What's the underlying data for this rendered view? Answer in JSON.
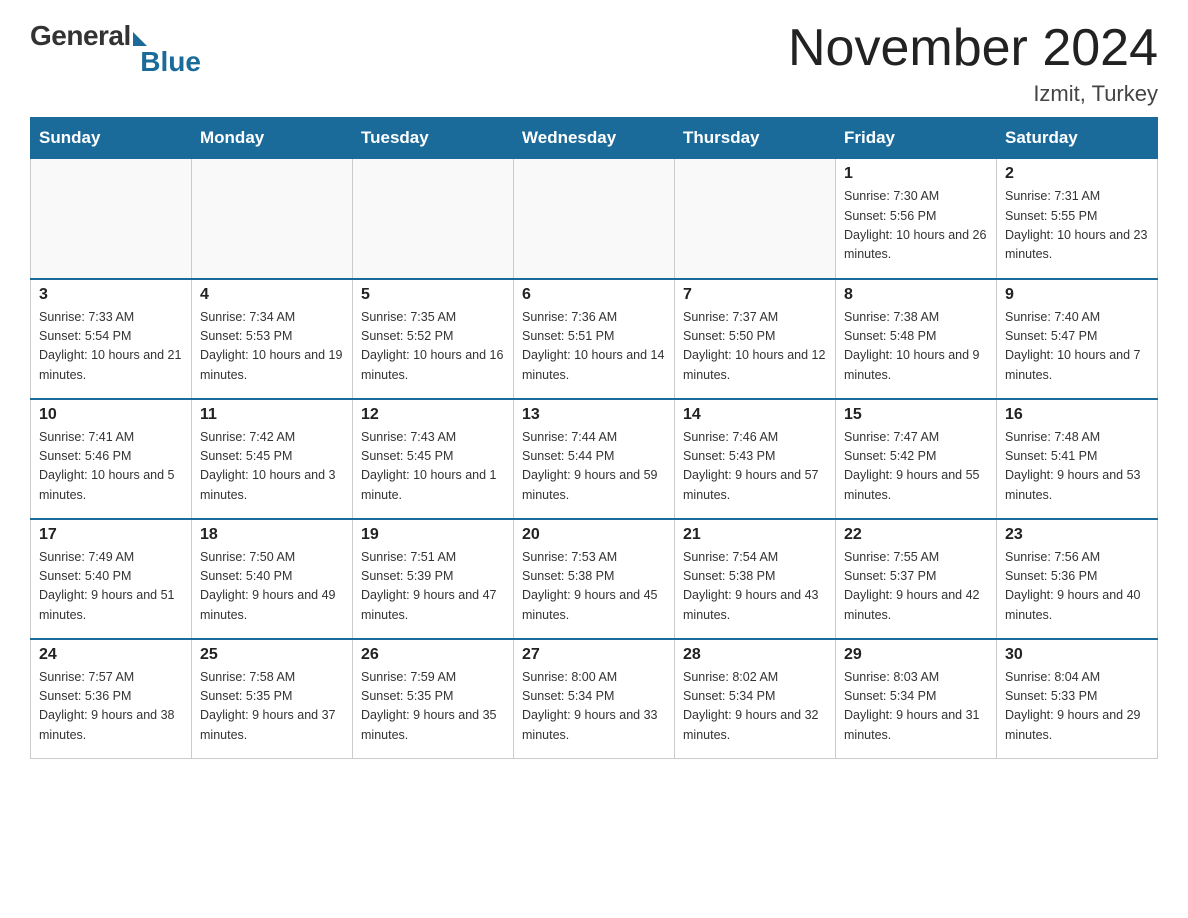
{
  "logo": {
    "general": "General",
    "blue": "Blue"
  },
  "title": "November 2024",
  "location": "Izmit, Turkey",
  "weekdays": [
    "Sunday",
    "Monday",
    "Tuesday",
    "Wednesday",
    "Thursday",
    "Friday",
    "Saturday"
  ],
  "weeks": [
    [
      {
        "day": "",
        "sunrise": "",
        "sunset": "",
        "daylight": ""
      },
      {
        "day": "",
        "sunrise": "",
        "sunset": "",
        "daylight": ""
      },
      {
        "day": "",
        "sunrise": "",
        "sunset": "",
        "daylight": ""
      },
      {
        "day": "",
        "sunrise": "",
        "sunset": "",
        "daylight": ""
      },
      {
        "day": "",
        "sunrise": "",
        "sunset": "",
        "daylight": ""
      },
      {
        "day": "1",
        "sunrise": "Sunrise: 7:30 AM",
        "sunset": "Sunset: 5:56 PM",
        "daylight": "Daylight: 10 hours and 26 minutes."
      },
      {
        "day": "2",
        "sunrise": "Sunrise: 7:31 AM",
        "sunset": "Sunset: 5:55 PM",
        "daylight": "Daylight: 10 hours and 23 minutes."
      }
    ],
    [
      {
        "day": "3",
        "sunrise": "Sunrise: 7:33 AM",
        "sunset": "Sunset: 5:54 PM",
        "daylight": "Daylight: 10 hours and 21 minutes."
      },
      {
        "day": "4",
        "sunrise": "Sunrise: 7:34 AM",
        "sunset": "Sunset: 5:53 PM",
        "daylight": "Daylight: 10 hours and 19 minutes."
      },
      {
        "day": "5",
        "sunrise": "Sunrise: 7:35 AM",
        "sunset": "Sunset: 5:52 PM",
        "daylight": "Daylight: 10 hours and 16 minutes."
      },
      {
        "day": "6",
        "sunrise": "Sunrise: 7:36 AM",
        "sunset": "Sunset: 5:51 PM",
        "daylight": "Daylight: 10 hours and 14 minutes."
      },
      {
        "day": "7",
        "sunrise": "Sunrise: 7:37 AM",
        "sunset": "Sunset: 5:50 PM",
        "daylight": "Daylight: 10 hours and 12 minutes."
      },
      {
        "day": "8",
        "sunrise": "Sunrise: 7:38 AM",
        "sunset": "Sunset: 5:48 PM",
        "daylight": "Daylight: 10 hours and 9 minutes."
      },
      {
        "day": "9",
        "sunrise": "Sunrise: 7:40 AM",
        "sunset": "Sunset: 5:47 PM",
        "daylight": "Daylight: 10 hours and 7 minutes."
      }
    ],
    [
      {
        "day": "10",
        "sunrise": "Sunrise: 7:41 AM",
        "sunset": "Sunset: 5:46 PM",
        "daylight": "Daylight: 10 hours and 5 minutes."
      },
      {
        "day": "11",
        "sunrise": "Sunrise: 7:42 AM",
        "sunset": "Sunset: 5:45 PM",
        "daylight": "Daylight: 10 hours and 3 minutes."
      },
      {
        "day": "12",
        "sunrise": "Sunrise: 7:43 AM",
        "sunset": "Sunset: 5:45 PM",
        "daylight": "Daylight: 10 hours and 1 minute."
      },
      {
        "day": "13",
        "sunrise": "Sunrise: 7:44 AM",
        "sunset": "Sunset: 5:44 PM",
        "daylight": "Daylight: 9 hours and 59 minutes."
      },
      {
        "day": "14",
        "sunrise": "Sunrise: 7:46 AM",
        "sunset": "Sunset: 5:43 PM",
        "daylight": "Daylight: 9 hours and 57 minutes."
      },
      {
        "day": "15",
        "sunrise": "Sunrise: 7:47 AM",
        "sunset": "Sunset: 5:42 PM",
        "daylight": "Daylight: 9 hours and 55 minutes."
      },
      {
        "day": "16",
        "sunrise": "Sunrise: 7:48 AM",
        "sunset": "Sunset: 5:41 PM",
        "daylight": "Daylight: 9 hours and 53 minutes."
      }
    ],
    [
      {
        "day": "17",
        "sunrise": "Sunrise: 7:49 AM",
        "sunset": "Sunset: 5:40 PM",
        "daylight": "Daylight: 9 hours and 51 minutes."
      },
      {
        "day": "18",
        "sunrise": "Sunrise: 7:50 AM",
        "sunset": "Sunset: 5:40 PM",
        "daylight": "Daylight: 9 hours and 49 minutes."
      },
      {
        "day": "19",
        "sunrise": "Sunrise: 7:51 AM",
        "sunset": "Sunset: 5:39 PM",
        "daylight": "Daylight: 9 hours and 47 minutes."
      },
      {
        "day": "20",
        "sunrise": "Sunrise: 7:53 AM",
        "sunset": "Sunset: 5:38 PM",
        "daylight": "Daylight: 9 hours and 45 minutes."
      },
      {
        "day": "21",
        "sunrise": "Sunrise: 7:54 AM",
        "sunset": "Sunset: 5:38 PM",
        "daylight": "Daylight: 9 hours and 43 minutes."
      },
      {
        "day": "22",
        "sunrise": "Sunrise: 7:55 AM",
        "sunset": "Sunset: 5:37 PM",
        "daylight": "Daylight: 9 hours and 42 minutes."
      },
      {
        "day": "23",
        "sunrise": "Sunrise: 7:56 AM",
        "sunset": "Sunset: 5:36 PM",
        "daylight": "Daylight: 9 hours and 40 minutes."
      }
    ],
    [
      {
        "day": "24",
        "sunrise": "Sunrise: 7:57 AM",
        "sunset": "Sunset: 5:36 PM",
        "daylight": "Daylight: 9 hours and 38 minutes."
      },
      {
        "day": "25",
        "sunrise": "Sunrise: 7:58 AM",
        "sunset": "Sunset: 5:35 PM",
        "daylight": "Daylight: 9 hours and 37 minutes."
      },
      {
        "day": "26",
        "sunrise": "Sunrise: 7:59 AM",
        "sunset": "Sunset: 5:35 PM",
        "daylight": "Daylight: 9 hours and 35 minutes."
      },
      {
        "day": "27",
        "sunrise": "Sunrise: 8:00 AM",
        "sunset": "Sunset: 5:34 PM",
        "daylight": "Daylight: 9 hours and 33 minutes."
      },
      {
        "day": "28",
        "sunrise": "Sunrise: 8:02 AM",
        "sunset": "Sunset: 5:34 PM",
        "daylight": "Daylight: 9 hours and 32 minutes."
      },
      {
        "day": "29",
        "sunrise": "Sunrise: 8:03 AM",
        "sunset": "Sunset: 5:34 PM",
        "daylight": "Daylight: 9 hours and 31 minutes."
      },
      {
        "day": "30",
        "sunrise": "Sunrise: 8:04 AM",
        "sunset": "Sunset: 5:33 PM",
        "daylight": "Daylight: 9 hours and 29 minutes."
      }
    ]
  ]
}
